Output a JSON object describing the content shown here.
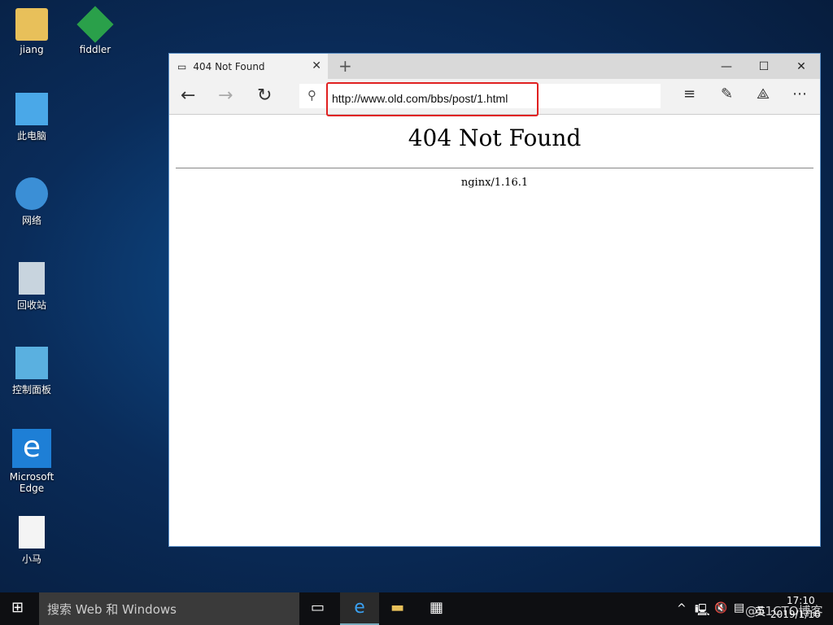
{
  "desktop": {
    "icons": [
      {
        "label": "jiang"
      },
      {
        "label": "fiddler"
      },
      {
        "label": "此电脑"
      },
      {
        "label": "网络"
      },
      {
        "label": "回收站"
      },
      {
        "label": "控制面板"
      },
      {
        "label": "Microsoft Edge"
      },
      {
        "label": "小马"
      }
    ]
  },
  "browser": {
    "tab_title": "404 Not Found",
    "url": "http://www.old.com/bbs/post/1.html",
    "page": {
      "heading": "404 Not Found",
      "server": "nginx/1.16.1"
    }
  },
  "taskbar": {
    "search_placeholder": "搜索 Web 和 Windows",
    "time": "17:10",
    "date": "2019/1/16",
    "ime": "英",
    "watermark": "@51CTO博客"
  }
}
